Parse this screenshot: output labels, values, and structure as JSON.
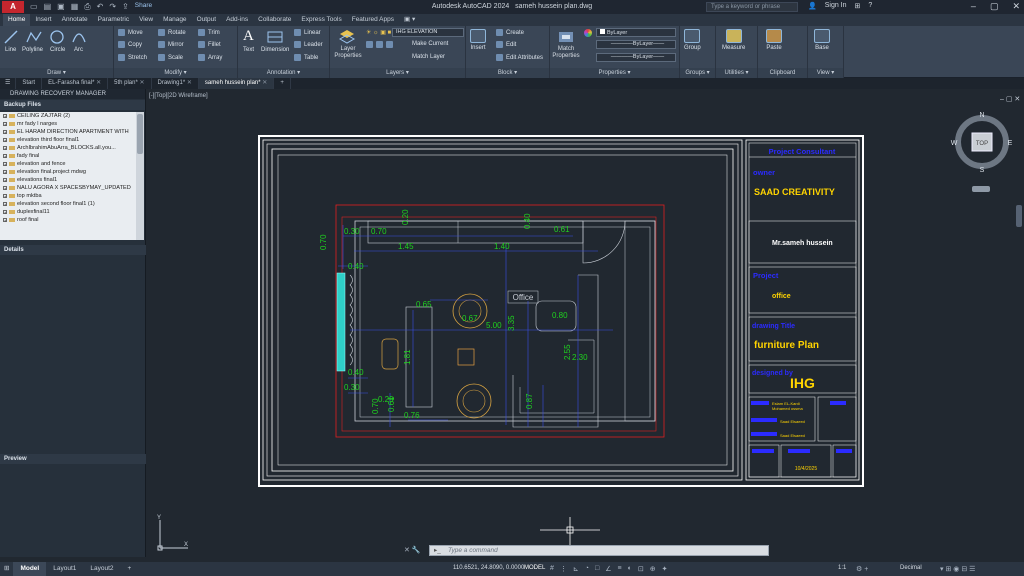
{
  "titlebar": {
    "logo": "A",
    "share": "Share",
    "app_title": "Autodesk AutoCAD 2024",
    "file_title": "sameh hussein plan.dwg",
    "search_placeholder": "Type a keyword or phrase",
    "sign_in": "Sign In"
  },
  "ribbon_tabs": [
    "Home",
    "Insert",
    "Annotate",
    "Parametric",
    "View",
    "Manage",
    "Output",
    "Add-ins",
    "Collaborate",
    "Express Tools",
    "Featured Apps"
  ],
  "ribbon": {
    "draw": {
      "title": "Draw",
      "line": "Line",
      "polyline": "Polyline",
      "circle": "Circle",
      "arc": "Arc"
    },
    "modify": {
      "title": "Modify",
      "move": "Move",
      "rotate": "Rotate",
      "trim": "Trim",
      "copy": "Copy",
      "mirror": "Mirror",
      "fillet": "Fillet",
      "stretch": "Stretch",
      "scale": "Scale",
      "array": "Array"
    },
    "annotation": {
      "title": "Annotation",
      "text": "Text",
      "dimension": "Dimension",
      "linear": "Linear",
      "leader": "Leader",
      "table": "Table"
    },
    "layers": {
      "title": "Layers",
      "layer_properties": "Layer Properties",
      "layer_combo": "IHG ELEVATION",
      "make_current": "Make Current",
      "match_layer": "Match Layer"
    },
    "block": {
      "title": "Block",
      "insert": "Insert",
      "create": "Create",
      "edit": "Edit",
      "edit_attributes": "Edit Attributes"
    },
    "properties": {
      "title": "Properties",
      "match_properties": "Match Properties",
      "bylayer1": "ByLayer",
      "bylayer2": "ByLayer",
      "bylayer3": "ByLayer"
    },
    "groups": {
      "title": "Groups",
      "group": "Group"
    },
    "utilities": {
      "title": "Utilities",
      "measure": "Measure"
    },
    "clipboard": {
      "title": "Clipboard",
      "paste": "Paste"
    },
    "view": {
      "title": "View",
      "base": "Base"
    }
  },
  "doc_tabs": [
    "Start",
    "EL-Farasha final*",
    "5th plan*",
    "Drawing1*",
    "sameh hussein plan*"
  ],
  "viewport_label": "[-][Top][2D Wireframe]",
  "left_palette": {
    "header": "DRAWING RECOVERY MANAGER",
    "backup_title": "Backup Files",
    "files": [
      "CEILING ZAJTAR (2)",
      "mr fady l narges",
      "EL HARAM DIRECTION APARTMENT WITH",
      "elevation third floor final1",
      "ArchIbrahimAbuArra_BLOCKS.all.you...",
      "fady final",
      "elevation and fence",
      "elevation final.project mdwg",
      "elevations final1",
      "NALU AGORA X SPACESBYMAY_UPDATED",
      "top mktba",
      "elevation second floor final1 (1)",
      "duplexfinal11",
      "roof final"
    ],
    "details": "Details",
    "preview": "Preview"
  },
  "drawing": {
    "room_label": "Office",
    "dims": [
      "0.30",
      "0.70",
      "0.20",
      "0.40",
      "0.61",
      "1.45",
      "1.40",
      "0.70",
      "0.40",
      "0.65",
      "0.67",
      "5.00",
      "3.35",
      "0.80",
      "2.55",
      "2.30",
      "1.81",
      "0.40",
      "0.30",
      "0.29",
      "0.70",
      "0.61",
      "0.76",
      "0.87"
    ]
  },
  "title_block": {
    "project_consultant": "Project Consultant",
    "owner_label": "owner",
    "company": "SAAD CREATIVITY",
    "owner_name": "Mr.sameh hussein",
    "project_label": "Project",
    "project_name": "office",
    "drawing_title_label": "drawing Title",
    "drawing_title": "furniture Plan",
    "designed_by_label": "designed by",
    "designer": "IHG",
    "team": [
      "Eslam EL-Kardi",
      "Mohamed ossma",
      "Saad Elsaeed",
      "Saad Elsaeed"
    ],
    "date": "10/4/2025"
  },
  "compass": {
    "n": "N",
    "s": "S",
    "e": "E",
    "w": "W",
    "cube": "TOP"
  },
  "command": {
    "placeholder": "Type a command"
  },
  "status": {
    "model_tab": "Model",
    "layout1": "Layout1",
    "layout2": "Layout2",
    "coords": "110.6521, 24.8090, 0.0000",
    "model": "MODEL",
    "scale": "1:1",
    "units": "Decimal"
  },
  "colors": {
    "dim_green": "#1fd11f",
    "cad_red": "#e02020",
    "frame_white": "#ffffff",
    "tb_blue": "#2b2bff",
    "tb_yellow": "#ffd400",
    "furniture": "#d9a441",
    "glass": "#2fd0c8"
  }
}
